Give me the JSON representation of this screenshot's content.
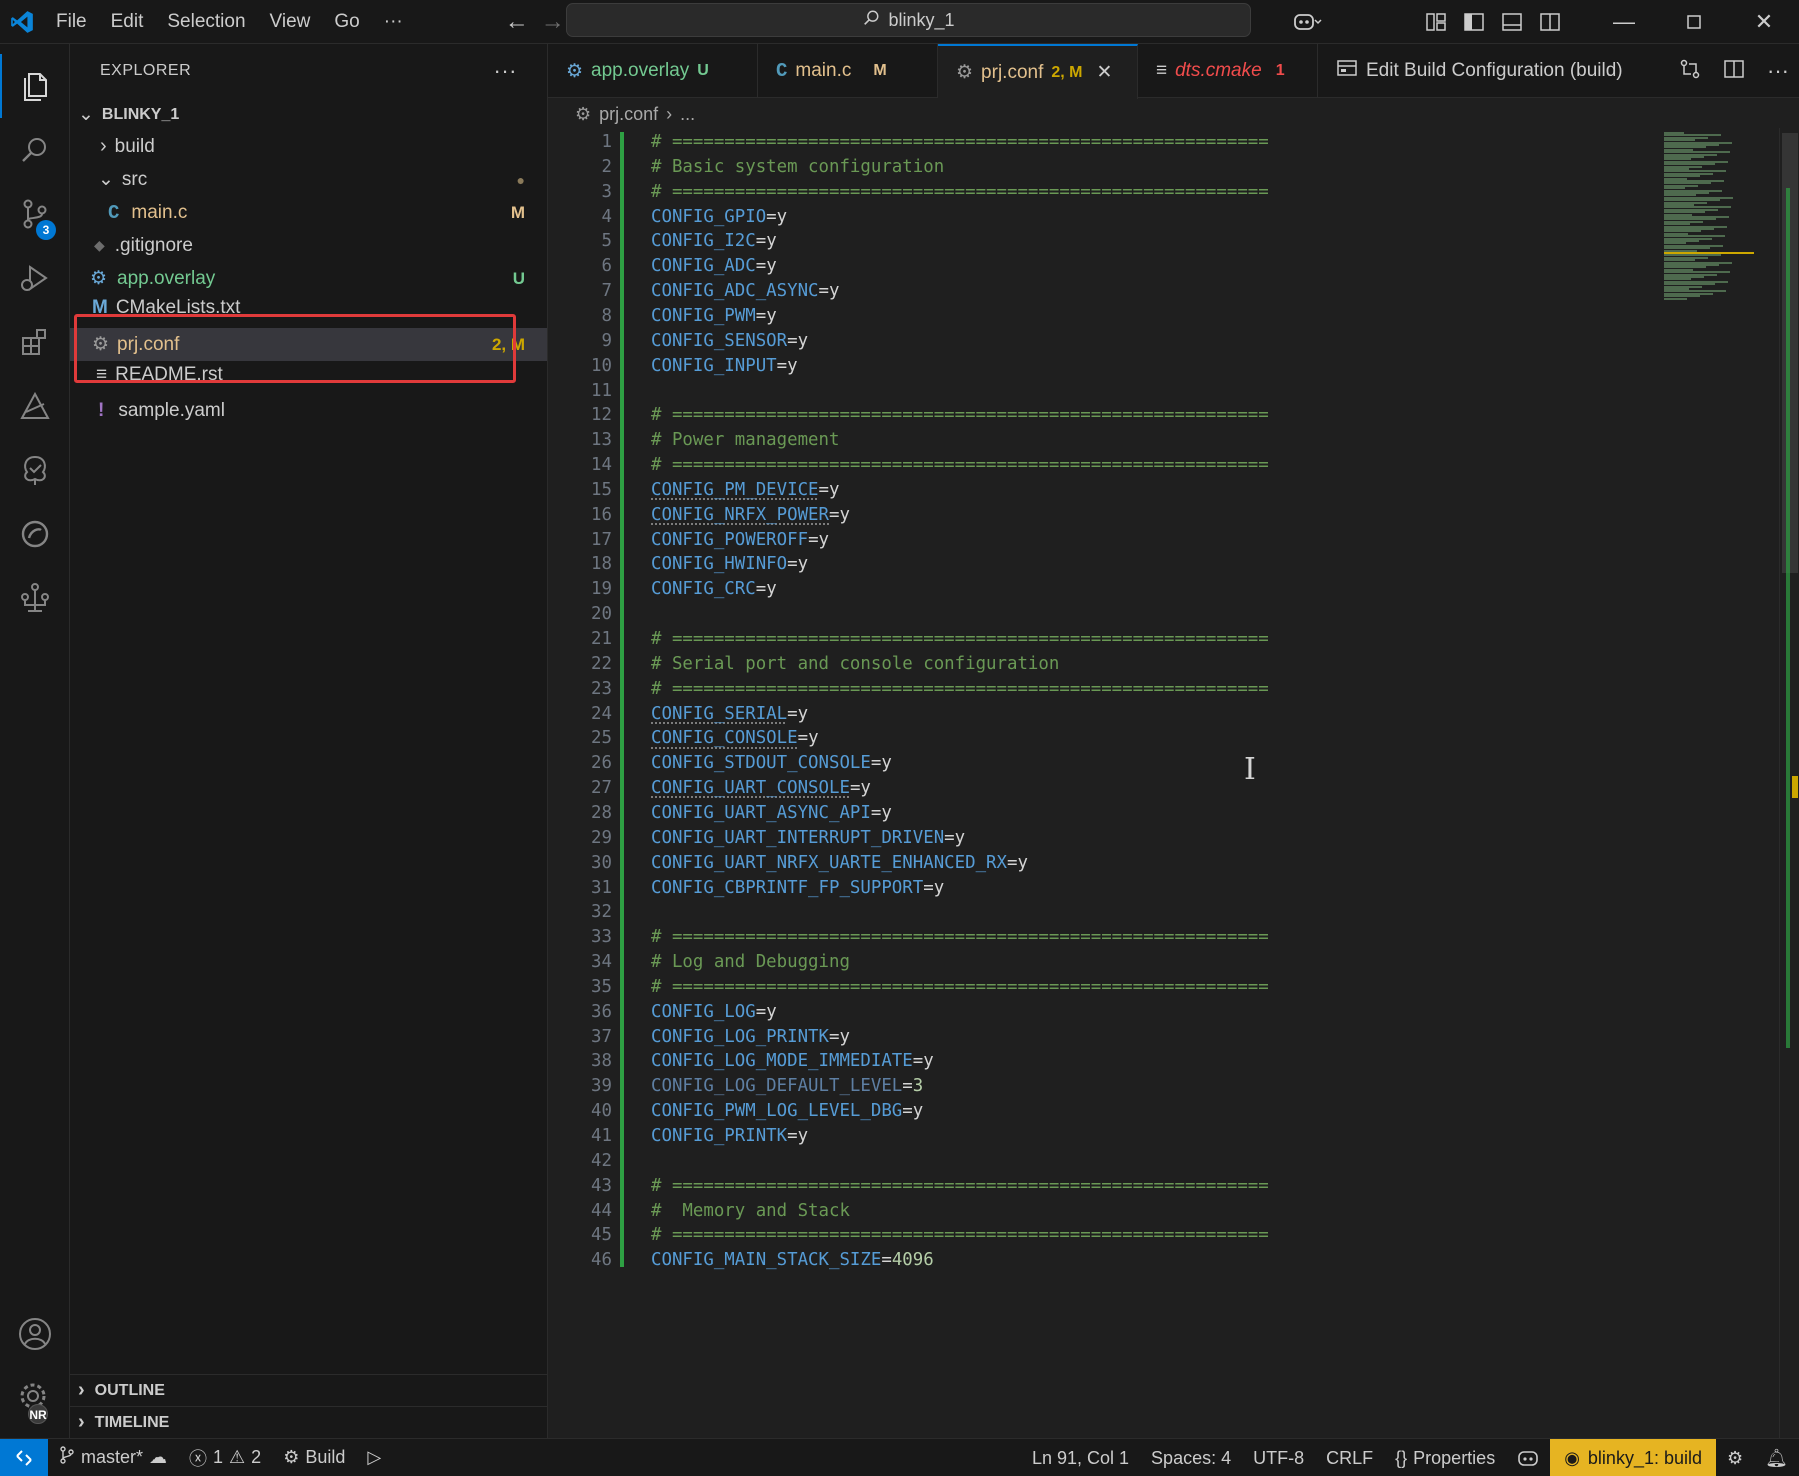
{
  "colors": {
    "accent": "#0078d4",
    "modified": "#e2c08d",
    "untracked": "#73c991",
    "error": "#f14c4c",
    "build_badge": "#e6b422"
  },
  "titlebar": {
    "menu": [
      "File",
      "Edit",
      "Selection",
      "View",
      "Go",
      "···"
    ],
    "search": "blinky_1"
  },
  "activity": {
    "scm_badge": "3",
    "account_badge": "NR"
  },
  "explorer": {
    "title": "EXPLORER",
    "root": "BLINKY_1",
    "items": [
      {
        "label": "build",
        "kind": "folder",
        "deco": ""
      },
      {
        "label": "src",
        "kind": "folder-open",
        "deco": "●"
      },
      {
        "label": "main.c",
        "kind": "c-file",
        "deco": "M"
      },
      {
        "label": ".gitignore",
        "kind": "git-file",
        "deco": ""
      },
      {
        "label": "app.overlay",
        "kind": "overlay-file",
        "deco": "U"
      },
      {
        "label": "CMakeLists.txt",
        "kind": "cmake-file",
        "deco": ""
      },
      {
        "label": "prj.conf",
        "kind": "gear-file",
        "deco": "2, M"
      },
      {
        "label": "README.rst",
        "kind": "text-file",
        "deco": ""
      },
      {
        "label": "sample.yaml",
        "kind": "yaml-file",
        "deco": ""
      }
    ],
    "outline": "OUTLINE",
    "timeline": "TIMELINE"
  },
  "tabs": [
    {
      "label": "app.overlay",
      "status": "U"
    },
    {
      "label": "main.c",
      "status": "M"
    },
    {
      "label": "prj.conf",
      "status": "2, M"
    },
    {
      "label": "dts.cmake",
      "status": "1"
    },
    {
      "label": "Edit Build Configuration (build)",
      "status": ""
    }
  ],
  "breadcrumb": {
    "file": "prj.conf",
    "more": "..."
  },
  "editor": {
    "lines": [
      {
        "n": "1",
        "t": "# ========================================================="
      },
      {
        "n": "2",
        "t": "# Basic system configuration"
      },
      {
        "n": "3",
        "t": "# ========================================================="
      },
      {
        "n": "4",
        "k": "CONFIG_GPIO",
        "v": "y"
      },
      {
        "n": "5",
        "k": "CONFIG_I2C",
        "v": "y"
      },
      {
        "n": "6",
        "k": "CONFIG_ADC",
        "v": "y"
      },
      {
        "n": "7",
        "k": "CONFIG_ADC_ASYNC",
        "v": "y"
      },
      {
        "n": "8",
        "k": "CONFIG_PWM",
        "v": "y"
      },
      {
        "n": "9",
        "k": "CONFIG_SENSOR",
        "v": "y"
      },
      {
        "n": "10",
        "k": "CONFIG_INPUT",
        "v": "y"
      },
      {
        "n": "11",
        "t": ""
      },
      {
        "n": "12",
        "t": "# ========================================================="
      },
      {
        "n": "13",
        "t": "# Power management"
      },
      {
        "n": "14",
        "t": "# ========================================================="
      },
      {
        "n": "15",
        "k": "CONFIG_PM_DEVICE",
        "v": "y"
      },
      {
        "n": "16",
        "k": "CONFIG_NRFX_POWER",
        "v": "y"
      },
      {
        "n": "17",
        "k": "CONFIG_POWEROFF",
        "v": "y"
      },
      {
        "n": "18",
        "k": "CONFIG_HWINFO",
        "v": "y"
      },
      {
        "n": "19",
        "k": "CONFIG_CRC",
        "v": "y"
      },
      {
        "n": "20",
        "t": ""
      },
      {
        "n": "21",
        "t": "# ========================================================="
      },
      {
        "n": "22",
        "t": "# Serial port and console configuration"
      },
      {
        "n": "23",
        "t": "# ========================================================="
      },
      {
        "n": "24",
        "k": "CONFIG_SERIAL",
        "v": "y"
      },
      {
        "n": "25",
        "k": "CONFIG_CONSOLE",
        "v": "y"
      },
      {
        "n": "26",
        "k": "CONFIG_STDOUT_CONSOLE",
        "v": "y"
      },
      {
        "n": "27",
        "k": "CONFIG_UART_CONSOLE",
        "v": "y"
      },
      {
        "n": "28",
        "k": "CONFIG_UART_ASYNC_API",
        "v": "y"
      },
      {
        "n": "29",
        "k": "CONFIG_UART_INTERRUPT_DRIVEN",
        "v": "y"
      },
      {
        "n": "30",
        "k": "CONFIG_UART_NRFX_UARTE_ENHANCED_RX",
        "v": "y"
      },
      {
        "n": "31",
        "k": "CONFIG_CBPRINTF_FP_SUPPORT",
        "v": "y"
      },
      {
        "n": "32",
        "t": ""
      },
      {
        "n": "33",
        "t": "# ========================================================="
      },
      {
        "n": "34",
        "t": "# Log and Debugging"
      },
      {
        "n": "35",
        "t": "# ========================================================="
      },
      {
        "n": "36",
        "k": "CONFIG_LOG",
        "v": "y"
      },
      {
        "n": "37",
        "k": "CONFIG_LOG_PRINTK",
        "v": "y"
      },
      {
        "n": "38",
        "k": "CONFIG_LOG_MODE_IMMEDIATE",
        "v": "y"
      },
      {
        "n": "39",
        "k": "CONFIG_LOG_DEFAULT_LEVEL",
        "v": "3"
      },
      {
        "n": "40",
        "k": "CONFIG_PWM_LOG_LEVEL_DBG",
        "v": "y"
      },
      {
        "n": "41",
        "k": "CONFIG_PRINTK",
        "v": "y"
      },
      {
        "n": "42",
        "t": ""
      },
      {
        "n": "43",
        "t": "# ========================================================="
      },
      {
        "n": "44",
        "t": "#  Memory and Stack"
      },
      {
        "n": "45",
        "t": "# ========================================================="
      },
      {
        "n": "46",
        "k": "CONFIG_MAIN_STACK_SIZE",
        "v": "4096"
      }
    ]
  },
  "statusbar": {
    "branch": "master*",
    "errors": "1",
    "warnings": "2",
    "build": "Build",
    "position": "Ln 91, Col 1",
    "spaces": "Spaces: 4",
    "encoding": "UTF-8",
    "eol": "CRLF",
    "language": "Properties",
    "build_context": "blinky_1: build"
  }
}
